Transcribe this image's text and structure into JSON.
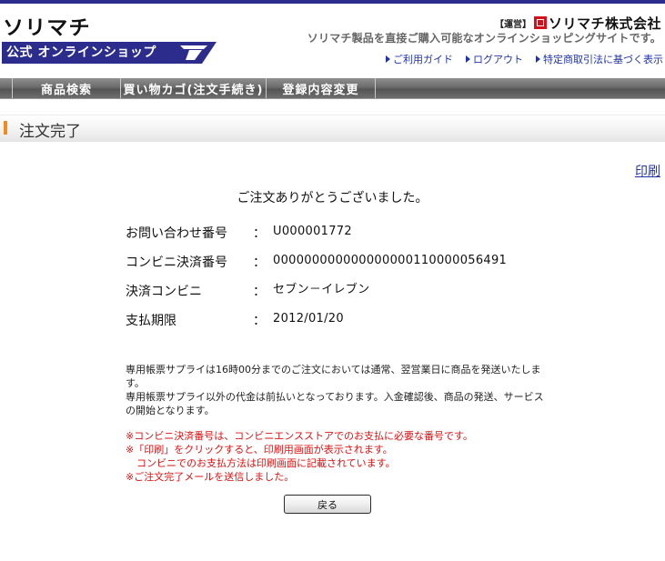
{
  "header": {
    "logo_text": "ソリマチ",
    "banner_text": "公式 オンラインショップ",
    "operator_label": "【運営】",
    "operator_name": "ソリマチ株式会社",
    "tagline": "ソリマチ製品を直接ご購入可能なオンラインショッピングサイトです。",
    "links": [
      "ご利用ガイド",
      "ログアウト",
      "特定商取引法に基づく表示"
    ]
  },
  "nav": {
    "items": [
      "商品検索",
      "買い物カゴ(注文手続き)",
      "登録内容変更"
    ]
  },
  "page": {
    "title": "注文完了",
    "print_label": "印刷",
    "thanks": "ご注文ありがとうございました。"
  },
  "order": {
    "rows": [
      {
        "label": "お問い合わせ番号",
        "sep": "：",
        "value": "U000001772"
      },
      {
        "label": "コンビニ決済番号",
        "sep": "：",
        "value": "000000000000000000110000056491"
      },
      {
        "label": "決済コンビニ",
        "sep": "：",
        "value": "セブン－イレブン"
      },
      {
        "label": "支払期限",
        "sep": "：",
        "value": "2012/01/20"
      }
    ]
  },
  "notes": [
    "専用帳票サプライは16時00分までのご注文においては通常、翌営業日に商品を発送いたします。",
    "専用帳票サプライ以外の代金は前払いとなっております。入金確認後、商品の発送、サービスの開始となります。"
  ],
  "warnings": [
    "※コンビニ決済番号は、コンビニエンスストアでのお支払に必要な番号です。",
    "※「印刷」をクリックすると、印刷用画面が表示されます。",
    "コンビニでのお支払方法は印刷画面に記載されています。",
    "※ご注文完了メールを送信しました。"
  ],
  "buttons": {
    "back_label": "戻る"
  },
  "colors": {
    "top_bar": "#2b2c8c",
    "banner_blue": "#2b2c8c",
    "link_blue": "#2033a8",
    "accent_orange": "#f28a1e",
    "warning_red": "#dd1111",
    "operator_red": "#d6101a"
  },
  "icons": {
    "link_bullet": "triangle-right-icon",
    "operator_mark": "company-logo-mark"
  }
}
